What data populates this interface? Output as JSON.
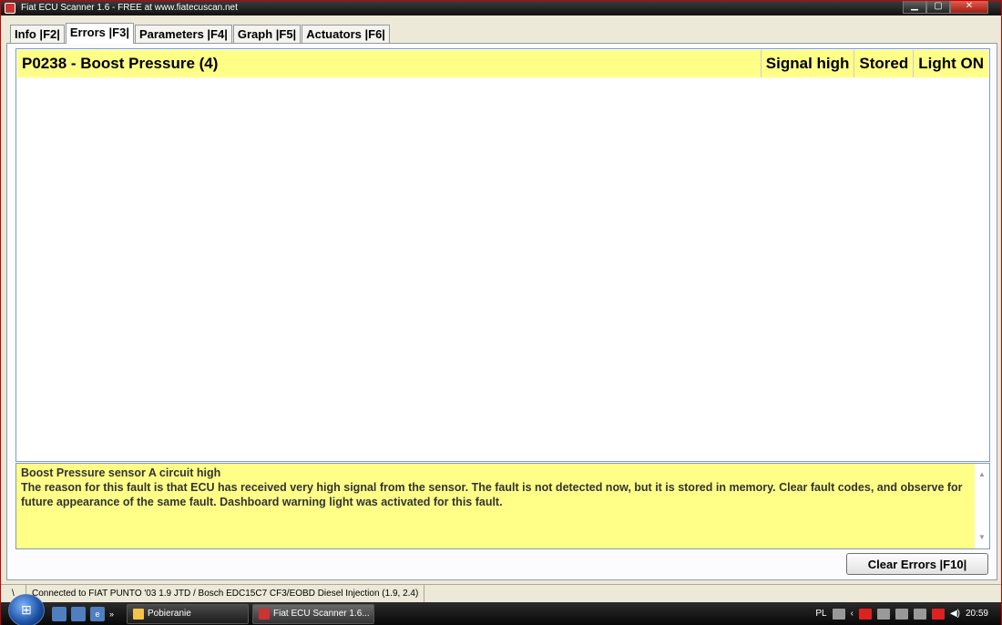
{
  "window": {
    "title": "Fiat ECU Scanner 1.6 - FREE at www.fiatecuscan.net",
    "minimize_icon": "minimize-icon",
    "maximize_icon": "maximize-icon",
    "close_icon": "close-icon"
  },
  "tabs": [
    {
      "label": "Info |F2|",
      "active": false
    },
    {
      "label": "Errors |F3|",
      "active": true
    },
    {
      "label": "Parameters |F4|",
      "active": false
    },
    {
      "label": "Graph |F5|",
      "active": false
    },
    {
      "label": "Actuators |F6|",
      "active": false
    }
  ],
  "errors": [
    {
      "code": "P0238 - Boost Pressure (4)",
      "signal": "Signal high",
      "status": "Stored",
      "light": "Light ON"
    }
  ],
  "description": {
    "title": "Boost Pressure sensor A circuit high",
    "body": "The reason for this fault is that ECU has received very high signal from the sensor. The fault is not detected now, but it is stored in memory. Clear fault codes, and observe for future appearance of the same fault. Dashboard warning light was activated for this fault."
  },
  "clear_button": "Clear Errors |F10|",
  "statusbar": {
    "indicator": "\\",
    "connection": "Connected to FIAT PUNTO '03 1.9 JTD / Bosch EDC15C7 CF3/EOBD Diesel Injection (1.9, 2.4)"
  },
  "taskbar": {
    "quick_launch_more": "»",
    "tasks": [
      {
        "label": "Pobieranie"
      },
      {
        "label": "Fiat ECU Scanner 1.6..."
      }
    ],
    "language": "PL",
    "clock": "20:59"
  }
}
